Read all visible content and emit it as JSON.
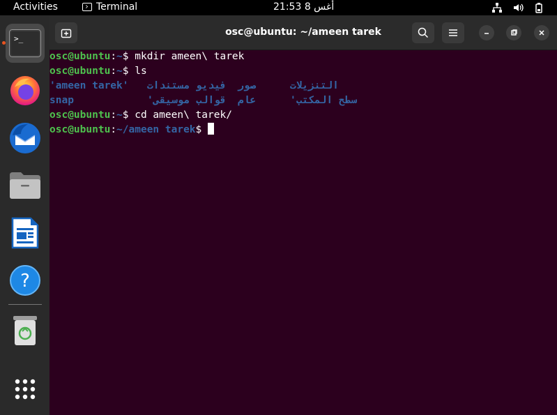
{
  "topbar": {
    "activities": "Activities",
    "app_name": "Terminal",
    "clock": "أغس 8  21:53"
  },
  "dock": {
    "items": [
      {
        "name": "terminal",
        "active": true
      },
      {
        "name": "firefox"
      },
      {
        "name": "thunderbird"
      },
      {
        "name": "files"
      },
      {
        "name": "libreoffice-writer"
      },
      {
        "name": "help"
      },
      {
        "name": "trash"
      },
      {
        "name": "show-applications"
      }
    ]
  },
  "window": {
    "title": "osc@ubuntu: ~/ameen tarek"
  },
  "terminal": {
    "user_host": "osc@ubuntu",
    "home_path": "~",
    "dir_path": "~/ameen tarek",
    "cmd1": " mkdir ameen\\ tarek",
    "cmd2": " ls",
    "cmd3": " cd ameen\\ tarek/",
    "ls_row1": [
      "'ameen tarek'",
      "مستندات",
      "فيديو",
      "صور",
      "التنزيلات"
    ],
    "ls_row2": [
      "snap",
      "'موسيقى",
      "قوالب",
      "عام",
      "'سطح المكتب"
    ]
  },
  "colors": {
    "background": "#2c001e",
    "prompt_user": "#4ec24e",
    "prompt_path": "#3465a4",
    "accent": "#e95420"
  }
}
